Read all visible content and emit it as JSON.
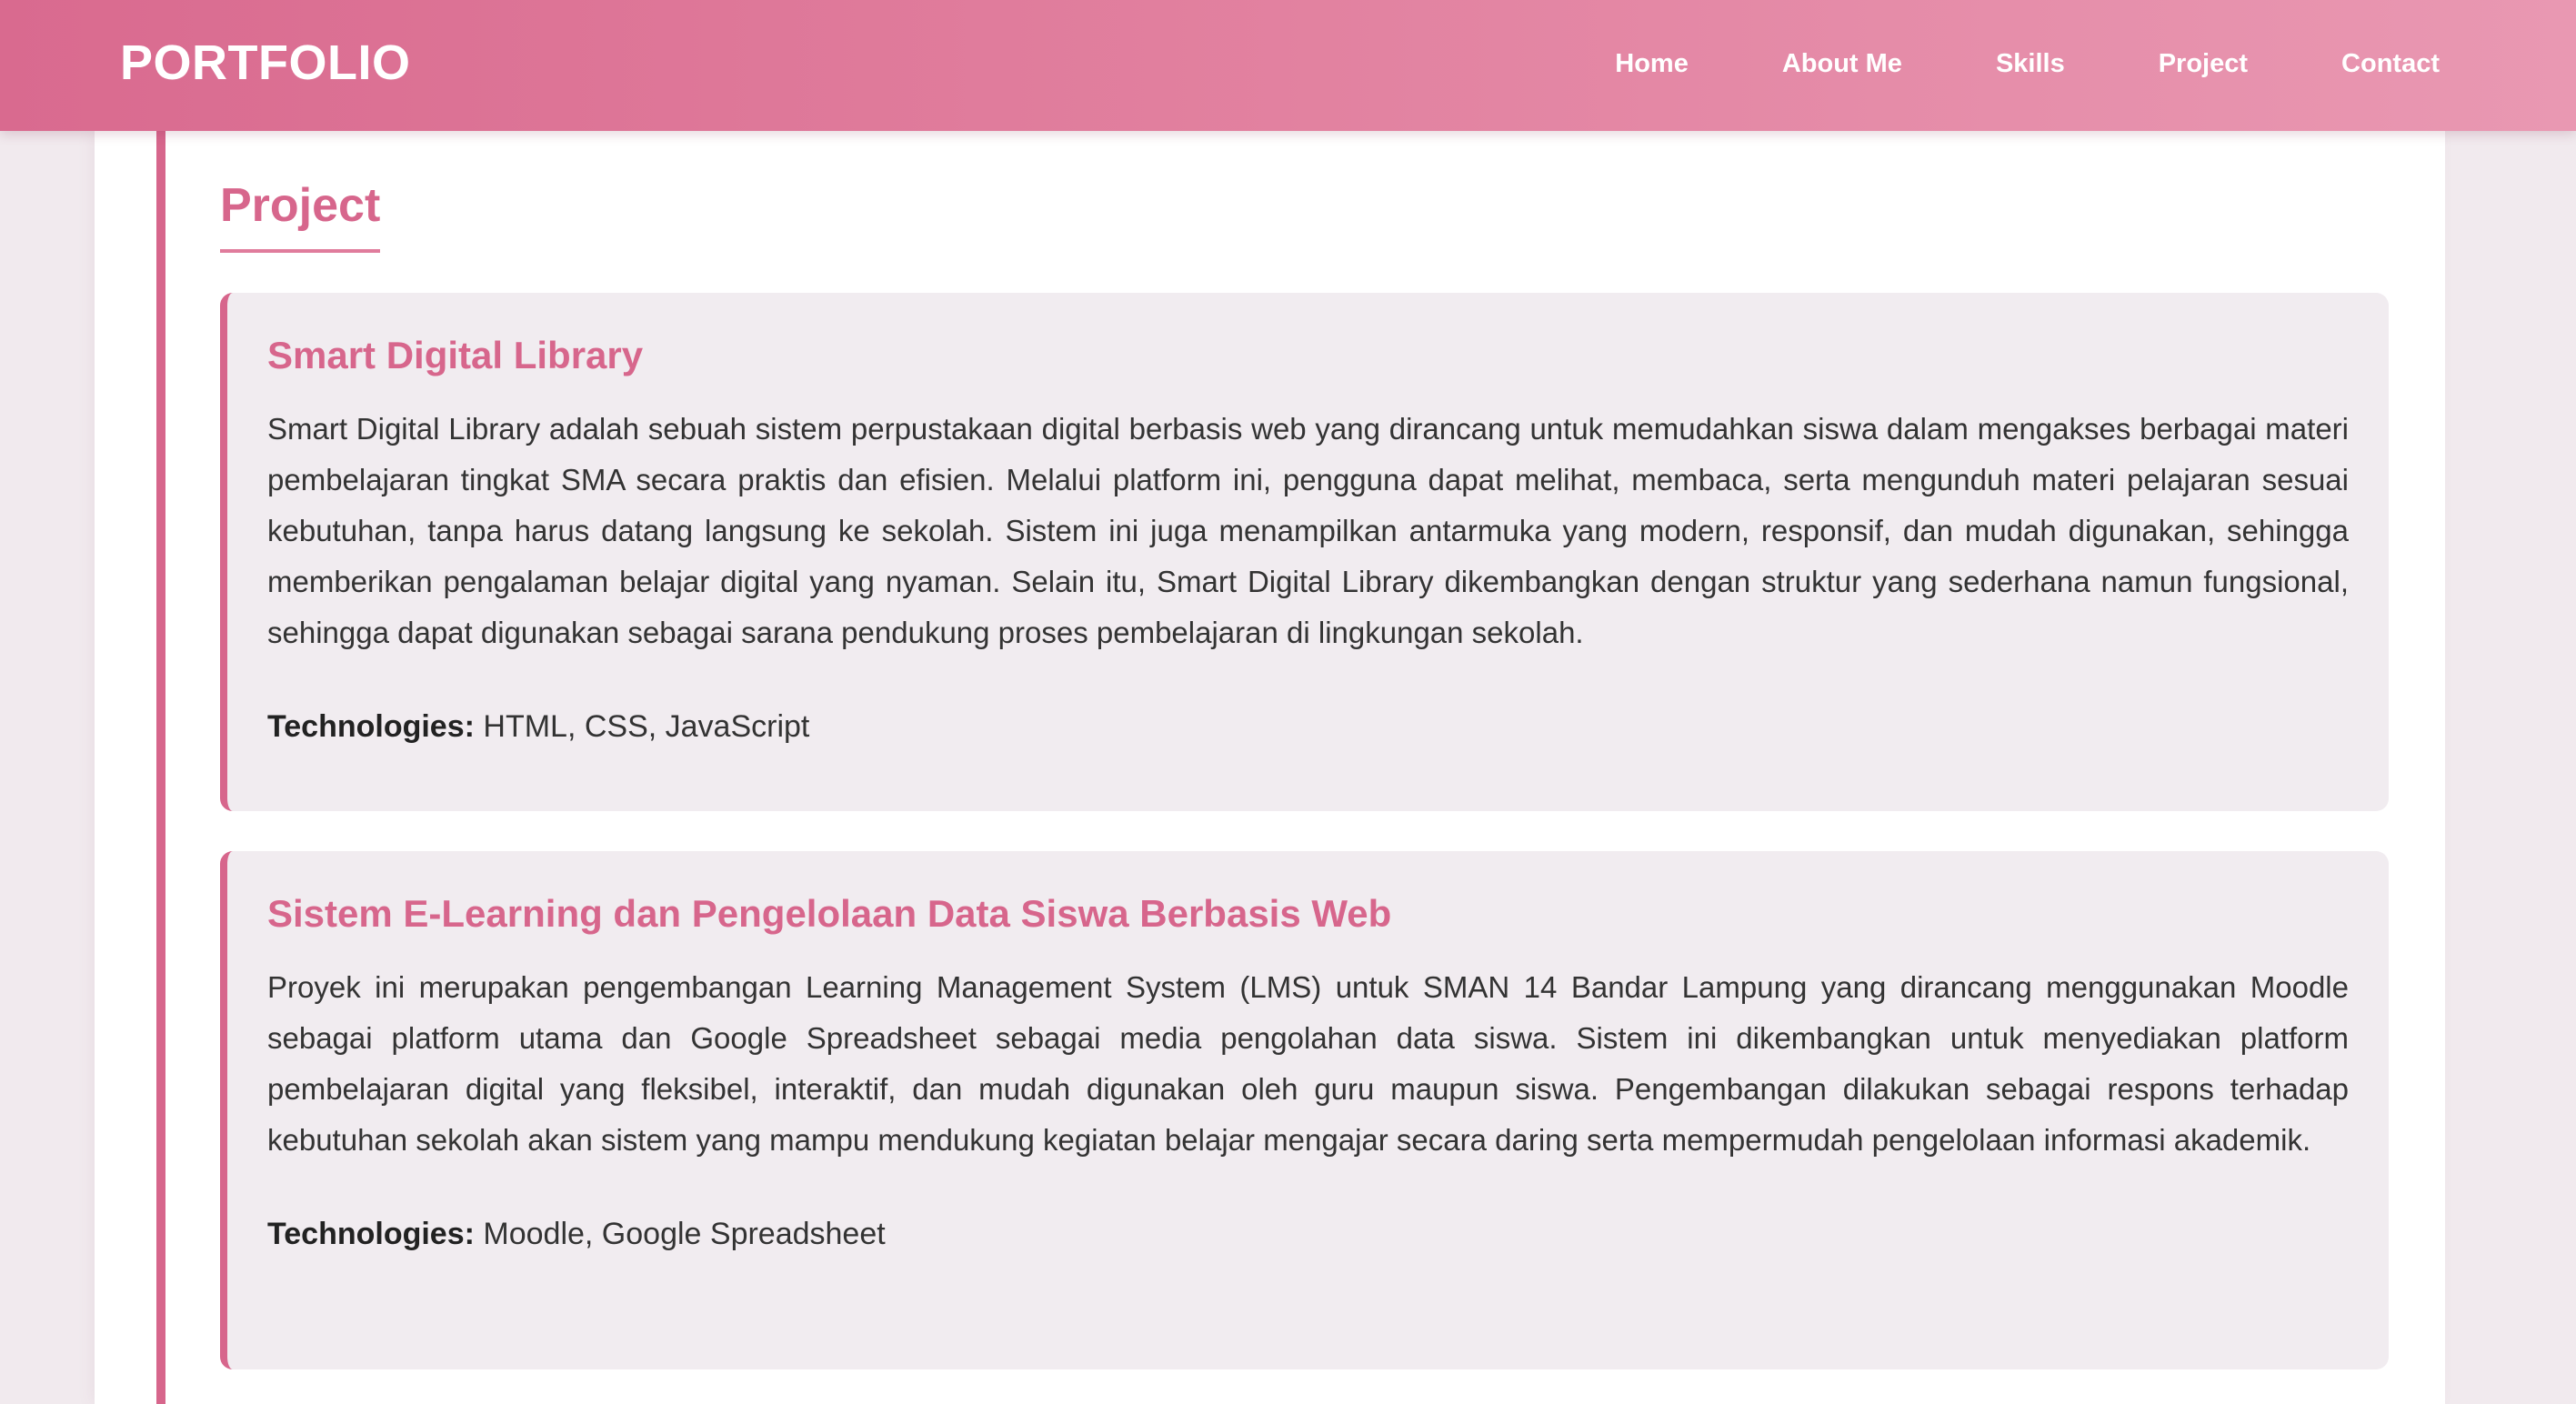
{
  "navbar": {
    "brand": "PORTFOLIO",
    "links": [
      "Home",
      "About Me",
      "Skills",
      "Project",
      "Contact"
    ]
  },
  "section": {
    "title": "Project"
  },
  "projects": [
    {
      "title": "Smart Digital Library",
      "description": "Smart Digital Library adalah sebuah sistem perpustakaan digital berbasis web yang dirancang untuk memudahkan siswa dalam mengakses berbagai materi pembelajaran tingkat SMA secara praktis dan efisien. Melalui platform ini, pengguna dapat melihat, membaca, serta mengunduh materi pelajaran sesuai kebutuhan, tanpa harus datang langsung ke sekolah. Sistem ini juga menampilkan antarmuka yang modern, responsif, dan mudah digunakan, sehingga memberikan pengalaman belajar digital yang nyaman. Selain itu, Smart Digital Library dikembangkan dengan struktur yang sederhana namun fungsional, sehingga dapat digunakan sebagai sarana pendukung proses pembelajaran di lingkungan sekolah.",
      "tech_label": "Technologies:",
      "tech_value": " HTML, CSS, JavaScript"
    },
    {
      "title": "Sistem E-Learning dan Pengelolaan Data Siswa Berbasis Web",
      "description": "Proyek ini merupakan pengembangan Learning Management System (LMS) untuk SMAN 14 Bandar Lampung yang dirancang menggunakan Moodle sebagai platform utama dan Google Spreadsheet sebagai media pengolahan data siswa. Sistem ini dikembangkan untuk menyediakan platform pembelajaran digital yang fleksibel, interaktif, dan mudah digunakan oleh guru maupun siswa. Pengembangan dilakukan sebagai respons terhadap kebutuhan sekolah akan sistem yang mampu mendukung kegiatan belajar mengajar secara daring serta mempermudah pengelolaan informasi akademik.",
      "tech_label": "Technologies:",
      "tech_value": " Moodle, Google Spreadsheet"
    }
  ],
  "colors": {
    "accent": "#d7668c",
    "nav_start": "#d96a8f",
    "nav_end": "#e998b2",
    "card_bg": "#f1ecf0",
    "page_bg": "#f1eaee"
  }
}
